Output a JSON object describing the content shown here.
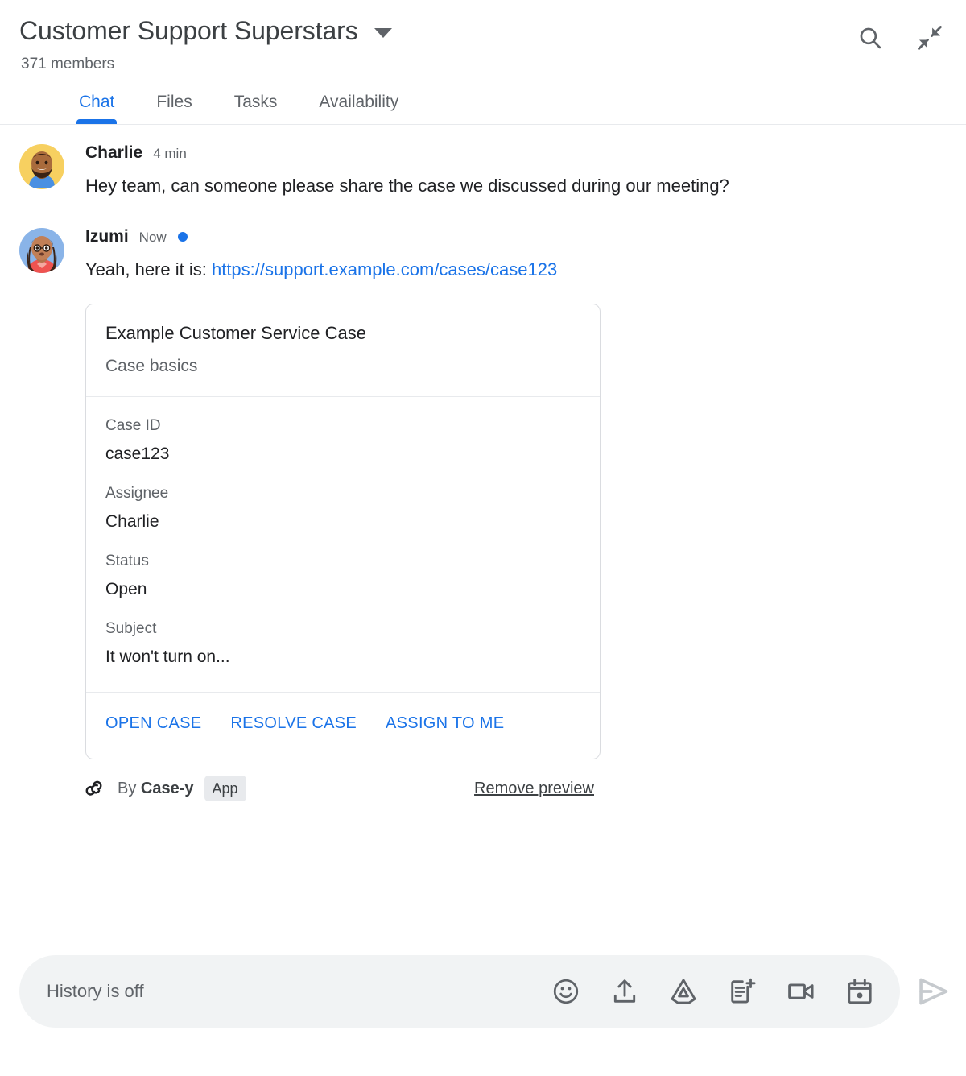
{
  "header": {
    "room_title": "Customer Support Superstars",
    "members": "371 members",
    "dropdown_icon": "chevron-down-icon",
    "search_icon": "search-icon",
    "collapse_icon": "collapse-icon"
  },
  "tabs": [
    {
      "label": "Chat",
      "active": true
    },
    {
      "label": "Files",
      "active": false
    },
    {
      "label": "Tasks",
      "active": false
    },
    {
      "label": "Availability",
      "active": false
    }
  ],
  "messages": [
    {
      "sender": "Charlie",
      "timestamp": "4 min",
      "unread": false,
      "text": "Hey team, can someone please share the case we discussed during our meeting?",
      "avatar": "charlie-avatar"
    },
    {
      "sender": "Izumi",
      "timestamp": "Now",
      "unread": true,
      "text_prefix": "Yeah, here it is: ",
      "link_text": "https://support.example.com/cases/case123",
      "avatar": "izumi-avatar"
    }
  ],
  "card": {
    "title": "Example Customer Service Case",
    "subtitle": "Case basics",
    "fields": [
      {
        "label": "Case ID",
        "value": "case123"
      },
      {
        "label": "Assignee",
        "value": "Charlie"
      },
      {
        "label": "Status",
        "value": "Open"
      },
      {
        "label": "Subject",
        "value": "It won't turn on..."
      }
    ],
    "actions": [
      {
        "label": "OPEN CASE"
      },
      {
        "label": "RESOLVE CASE"
      },
      {
        "label": "ASSIGN TO ME"
      }
    ],
    "footer": {
      "app_icon": "webhook-icon",
      "by_prefix": "By ",
      "app_name": "Case-y",
      "app_badge": "App",
      "remove_preview": "Remove preview"
    }
  },
  "compose": {
    "placeholder": "History is off",
    "icons": [
      "emoji-icon",
      "upload-icon",
      "google-drive-icon",
      "add-document-icon",
      "video-camera-icon",
      "calendar-icon"
    ],
    "send_icon": "send-icon"
  },
  "colors": {
    "accent": "#1a73e8",
    "text_primary": "#202124",
    "text_secondary": "#5f6368",
    "border": "#dadce0",
    "compose_bg": "#f1f3f4",
    "badge_bg": "#e8eaed"
  }
}
